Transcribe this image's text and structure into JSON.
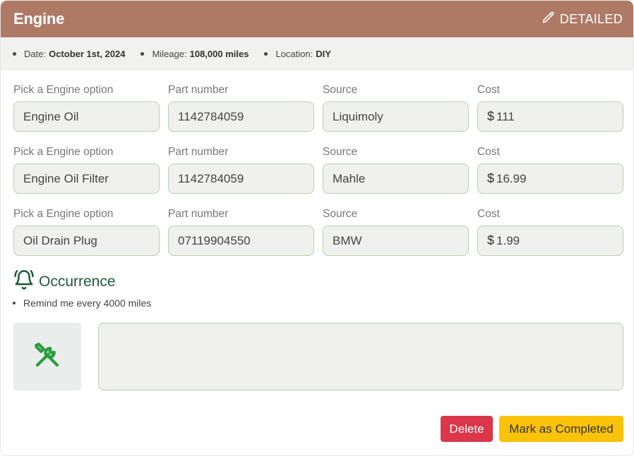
{
  "header": {
    "title": "Engine",
    "mode_label": "DETAILED",
    "mode_icon": "pencil-icon",
    "color": "#ae7a66"
  },
  "meta": {
    "date_label": "Date:",
    "date_value": "October 1st, 2024",
    "mileage_label": "Mileage:",
    "mileage_value": "108,000 miles",
    "location_label": "Location:",
    "location_value": "DIY"
  },
  "parts": [
    {
      "option_label": "Pick a Engine option",
      "option_value": "Engine Oil",
      "part_label": "Part number",
      "part_value": "1142784059",
      "source_label": "Source",
      "source_value": "Liquimoly",
      "cost_label": "Cost",
      "currency": "$",
      "cost_value": "111"
    },
    {
      "option_label": "Pick a Engine option",
      "option_value": "Engine Oil Filter",
      "part_label": "Part number",
      "part_value": "1142784059",
      "source_label": "Source",
      "source_value": "Mahle",
      "cost_label": "Cost",
      "currency": "$",
      "cost_value": "16.99"
    },
    {
      "option_label": "Pick a Engine option",
      "option_value": "Oil Drain Plug",
      "part_label": "Part number",
      "part_value": "07119904550",
      "source_label": "Source",
      "source_value": "BMW",
      "cost_label": "Cost",
      "currency": "$",
      "cost_value": "1.99"
    }
  ],
  "occurrence": {
    "title": "Occurrence",
    "icon": "bell-ring-icon",
    "reminder": "Remind me every 4000 miles",
    "color": "#1f5a3c"
  },
  "notes": {
    "tool_icon": "wrench-screwdriver-icon",
    "value": ""
  },
  "actions": {
    "delete_label": "Delete",
    "delete_color": "#db3649",
    "complete_label": "Mark as Completed",
    "complete_color": "#fbc20a"
  }
}
